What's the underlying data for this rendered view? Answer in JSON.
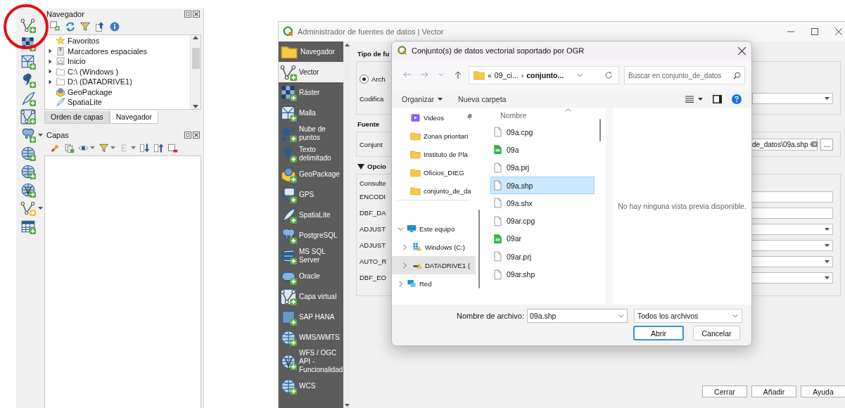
{
  "annotation": {
    "kind": "circle"
  },
  "layer_toolbar": [
    {
      "kind": "vertex_plus",
      "menu": false
    },
    {
      "kind": "checker_plus",
      "menu": false
    },
    {
      "kind": "mesh_plus",
      "menu": false
    },
    {
      "kind": "comma_plus",
      "menu": false
    },
    {
      "kind": "feather_plus",
      "menu": false
    },
    {
      "kind": "virtual_plus",
      "menu": false
    },
    {
      "kind": "elephant_plus",
      "menu": true
    },
    {
      "kind": "globe_plus",
      "menu": false
    },
    {
      "kind": "globe_plus",
      "menu": false
    },
    {
      "kind": "globe_v_plus",
      "menu": false
    },
    {
      "kind": "vertex_star",
      "menu": true
    },
    {
      "kind": "table_plus",
      "menu": false
    }
  ],
  "navigator_panel": {
    "title": "Navegador",
    "items": [
      {
        "label": "Favoritos",
        "kind": "star",
        "expandable": false
      },
      {
        "label": "Marcadores espaciales",
        "kind": "bookmark",
        "expandable": true
      },
      {
        "label": "Inicio",
        "kind": "home",
        "expandable": true
      },
      {
        "label": "C:\\ (Windows )",
        "kind": "folder_outline",
        "expandable": true
      },
      {
        "label": "D:\\ (DATADRIVE1)",
        "kind": "folder_outline",
        "expandable": true
      },
      {
        "label": "GeoPackage",
        "kind": "geopackage",
        "expandable": false
      },
      {
        "label": "SpatiaLite",
        "kind": "feather",
        "expandable": false
      }
    ]
  },
  "panel_tabs": [
    {
      "label": "Orden de capas",
      "selected": false
    },
    {
      "label": "Navegador",
      "selected": true
    }
  ],
  "layers_panel": {
    "title": "Capas"
  },
  "source_manager": {
    "title": "Administrador de fuentes de datos | Vector",
    "sidebar": [
      {
        "label": "Navegador",
        "kind": "folder",
        "selected": false
      },
      {
        "label": "Vector",
        "kind": "vertex",
        "selected": true
      },
      {
        "label": "Ráster",
        "kind": "checker",
        "selected": false
      },
      {
        "label": "Malla",
        "kind": "mesh",
        "selected": false
      },
      {
        "label": "Nube de puntos",
        "kind": "pointcloud",
        "selected": false
      },
      {
        "label": "Texto delimitado",
        "kind": "comma",
        "selected": false
      },
      {
        "label": "GeoPackage",
        "kind": "geopackage",
        "selected": false
      },
      {
        "label": "GPS",
        "kind": "gps",
        "selected": false
      },
      {
        "label": "SpatiaLite",
        "kind": "feather",
        "selected": false
      },
      {
        "label": "PostgreSQL",
        "kind": "elephant",
        "selected": false
      },
      {
        "label": "MS SQL Server",
        "kind": "fan",
        "selected": false
      },
      {
        "label": "Oracle",
        "kind": "oracle",
        "selected": false
      },
      {
        "label": "Capa virtual",
        "kind": "virtual",
        "selected": false
      },
      {
        "label": "SAP HANA",
        "kind": "hana",
        "selected": false
      },
      {
        "label": "WMS/WMTS",
        "kind": "globe",
        "selected": false
      },
      {
        "label": "WFS / OGC API - Funcionalidad",
        "kind": "globe_v",
        "selected": false
      },
      {
        "label": "WCS",
        "kind": "globe",
        "selected": false
      }
    ],
    "source_type": {
      "heading": "Tipo de fu",
      "option": {
        "label": "Arch",
        "checked": true
      },
      "encoding_label": "Codifica"
    },
    "source": {
      "heading": "Fuente",
      "label": "Conjunt",
      "value": "de_datos\\09a.shp",
      "browse": "..."
    },
    "options": {
      "heading": "Opcio",
      "expanded": true,
      "note": "Consulte",
      "rows": [
        {
          "label": "ENCODI",
          "kind": "text"
        },
        {
          "label": "DBF_DA",
          "kind": "text"
        },
        {
          "label": "ADJUST",
          "kind": "combo"
        },
        {
          "label": "ADJUST",
          "kind": "combo"
        },
        {
          "label": "AUTO_R",
          "kind": "combo"
        },
        {
          "label": "DBF_EO",
          "kind": "combo"
        }
      ]
    },
    "buttons": [
      "Cerrar",
      "Añadir",
      "Ayuda"
    ]
  },
  "file_dialog": {
    "title": "Conjunto(s) de datos vectorial soportado por OGR",
    "address": {
      "overflow_mark": "«",
      "crumbs": [
        "09_ci...",
        "conjunto..."
      ],
      "separator": "›"
    },
    "search": {
      "placeholder": "Buscar en conjunto_de_datos"
    },
    "commands": [
      {
        "label": "Organizar",
        "menu": true
      },
      {
        "label": "Nueva carpeta",
        "menu": false
      }
    ],
    "nav_items": [
      {
        "label": "Videos",
        "kind": "video",
        "pinned": true,
        "selected": false
      },
      {
        "label": "Zonas prioritari",
        "kind": "folder",
        "pinned": false,
        "selected": false
      },
      {
        "label": "Instituto de Pla",
        "kind": "folder",
        "pinned": false,
        "selected": false
      },
      {
        "label": "Oficios_DIEG",
        "kind": "folder",
        "pinned": false,
        "selected": false
      },
      {
        "label": "conjunto_de_da",
        "kind": "folder",
        "pinned": false,
        "selected": false
      }
    ],
    "tree_items": [
      {
        "label": "Este equipo",
        "kind": "monitor",
        "expanded": true,
        "selected": false,
        "children": [
          {
            "label": "Windows  (C:)",
            "kind": "windows_drive",
            "expanded": false,
            "selected": false
          },
          {
            "label": "DATADRIVE1 (",
            "kind": "drive",
            "expanded": false,
            "selected": true
          }
        ]
      },
      {
        "label": "Red",
        "kind": "network",
        "expanded": false,
        "selected": false
      }
    ],
    "column": "Nombre",
    "files": [
      {
        "name": "09a.cpg",
        "kind": "file",
        "selected": false
      },
      {
        "name": "09a",
        "kind": "sheet",
        "selected": false
      },
      {
        "name": "09a.prj",
        "kind": "file",
        "selected": false
      },
      {
        "name": "09a.shp",
        "kind": "file",
        "selected": true
      },
      {
        "name": "09a.shx",
        "kind": "file",
        "selected": false
      },
      {
        "name": "09ar.cpg",
        "kind": "file",
        "selected": false
      },
      {
        "name": "09ar",
        "kind": "sheet",
        "selected": false
      },
      {
        "name": "09ar.prj",
        "kind": "file",
        "selected": false
      },
      {
        "name": "09ar.shp",
        "kind": "file",
        "selected": false
      }
    ],
    "preview": "No hay ninguna vista previa disponible.",
    "filename_label": "Nombre de archivo:",
    "filename": "09a.shp",
    "filter": "Todos los archivos",
    "buttons": [
      {
        "label": "Abrir",
        "default": true
      },
      {
        "label": "Cancelar",
        "default": false
      }
    ]
  }
}
